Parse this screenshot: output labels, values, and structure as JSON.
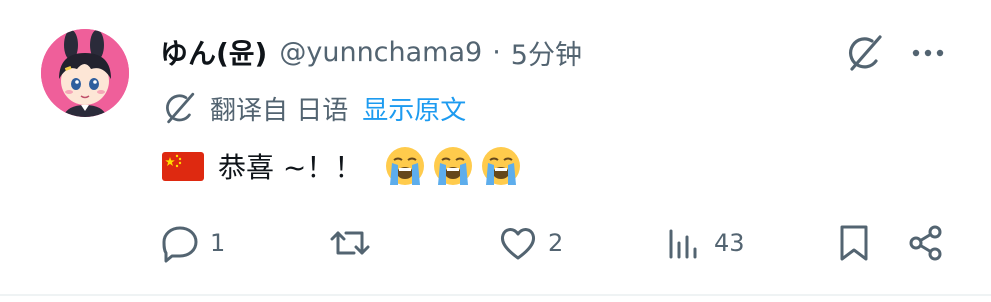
{
  "post": {
    "author": {
      "display_name": "ゆん(윤)",
      "handle": "@yunnchama9"
    },
    "separator": "·",
    "time": "5分钟",
    "translation": {
      "translated_from": "翻译自 日语",
      "show_original_label": "显示原文"
    },
    "text": "恭喜 ~！！",
    "flag_icon": "china-flag-icon",
    "emojis": [
      "loudly-crying-face-icon",
      "loudly-crying-face-icon",
      "loudly-crying-face-icon"
    ],
    "actions": {
      "reply_count": "1",
      "repost_count": "",
      "like_count": "2",
      "views_count": "43"
    }
  },
  "colors": {
    "text_primary": "#0f1419",
    "text_secondary": "#536471",
    "link_blue": "#1d9bf0",
    "avatar_bg": "#ef5f9a",
    "divider": "#eff3f4"
  }
}
